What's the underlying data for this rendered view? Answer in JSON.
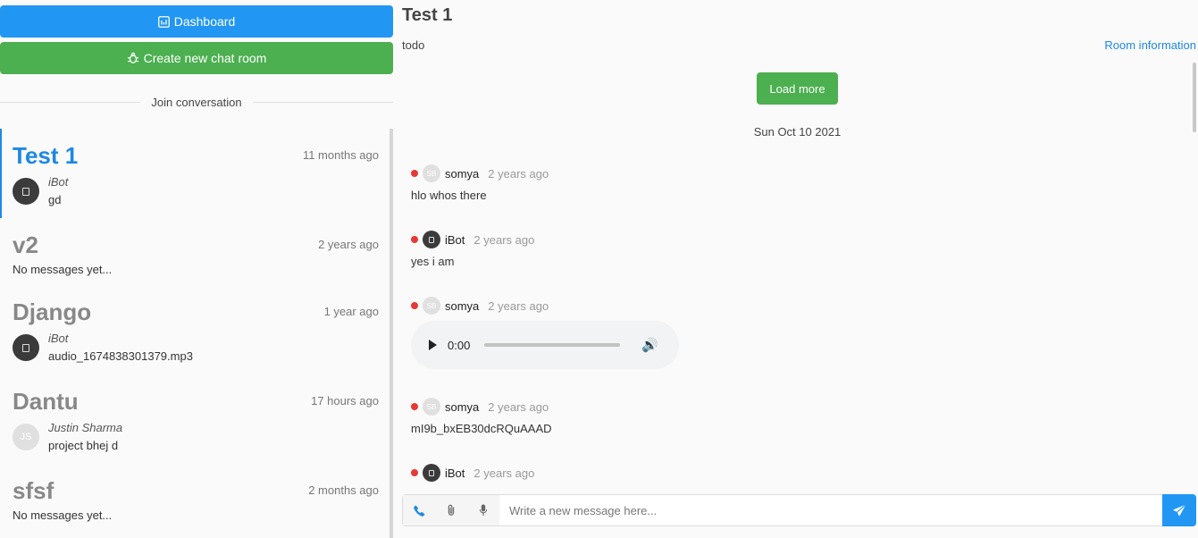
{
  "sidebar": {
    "dashboard_label": "Dashboard",
    "create_label": "Create new chat room",
    "join_label": "Join conversation",
    "rooms": [
      {
        "name": "Test 1",
        "time": "11 months ago",
        "sender": "iBot",
        "message": "gd"
      },
      {
        "name": "v2",
        "time": "2 years ago",
        "no_messages": "No messages yet..."
      },
      {
        "name": "Django",
        "time": "1 year ago",
        "sender": "iBot",
        "message": "audio_1674838301379.mp3"
      },
      {
        "name": "Dantu",
        "time": "17 hours ago",
        "sender": "Justin Sharma",
        "message": "project bhej d",
        "initials": "JS"
      },
      {
        "name": "sfsf",
        "time": "2 months ago",
        "no_messages": "No messages yet..."
      }
    ]
  },
  "room": {
    "title": "Test 1",
    "description": "todo",
    "info_link": "Room information"
  },
  "chat": {
    "load_more_label": "Load more",
    "date": "Sun Oct 10 2021",
    "messages": [
      {
        "user": "somya",
        "initials": "SB",
        "time": "2 years ago",
        "body": "hlo whos there"
      },
      {
        "user": "iBot",
        "time": "2 years ago",
        "body": "yes i am"
      },
      {
        "user": "somya",
        "initials": "SB",
        "time": "2 years ago",
        "audio_time": "0:00"
      },
      {
        "user": "somya",
        "initials": "SB",
        "time": "2 years ago",
        "body": "mI9b_bxEB30dcRQuAAAD"
      },
      {
        "user": "iBot",
        "time": "2 years ago"
      }
    ]
  },
  "composer": {
    "placeholder": "Write a new message here..."
  },
  "colors": {
    "primary": "#2196f3",
    "success": "#4caf50",
    "active_room": "#1e88e5",
    "online_dot": "#e53935"
  }
}
